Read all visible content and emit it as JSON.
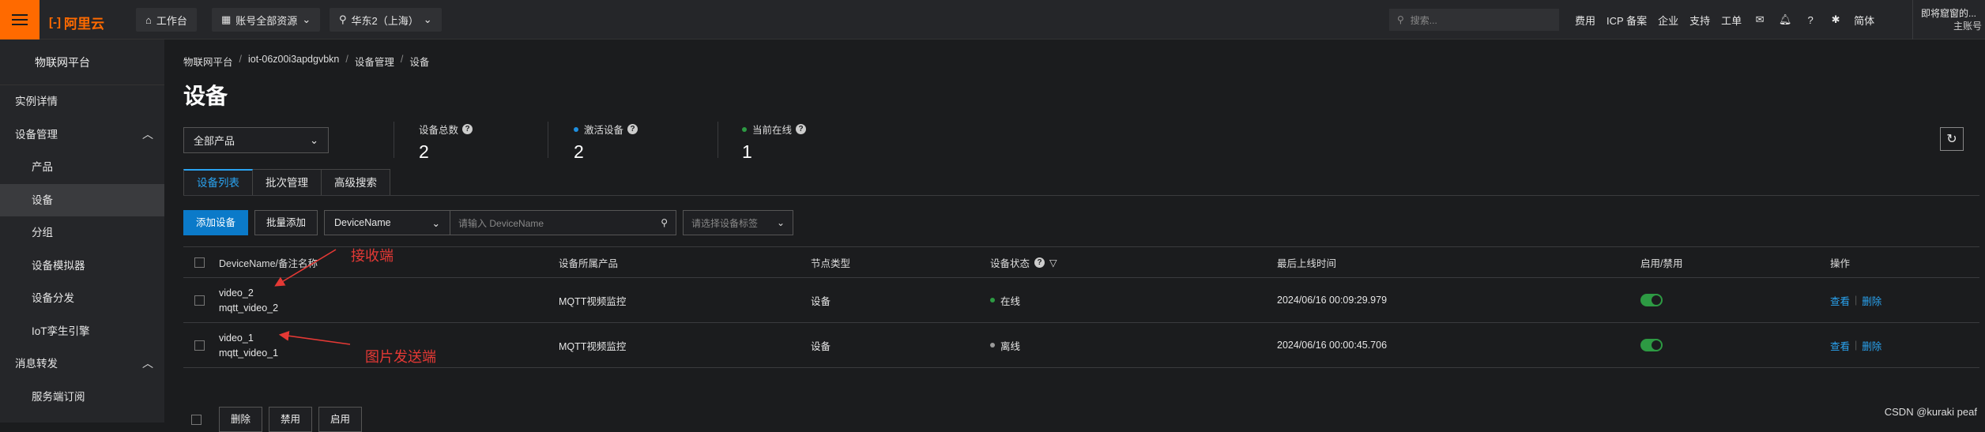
{
  "topbar": {
    "brand": "阿里云",
    "workbench": "工作台",
    "account": "账号全部资源",
    "region": "华东2（上海）",
    "search_placeholder": "搜索...",
    "links": [
      "费用",
      "ICP 备案",
      "企业",
      "支持",
      "工单"
    ],
    "lang": "简体",
    "user_line1": "即将窟窗的...",
    "user_line2": "主账号"
  },
  "sidebar": {
    "title": "物联网平台",
    "items": [
      {
        "label": "实例详情",
        "level": "top"
      },
      {
        "label": "设备管理",
        "level": "top",
        "expanded": true
      },
      {
        "label": "产品",
        "level": "sub"
      },
      {
        "label": "设备",
        "level": "sub",
        "active": true
      },
      {
        "label": "分组",
        "level": "sub"
      },
      {
        "label": "设备模拟器",
        "level": "sub"
      },
      {
        "label": "设备分发",
        "level": "sub"
      },
      {
        "label": "IoT孪生引擎",
        "level": "sub"
      },
      {
        "label": "消息转发",
        "level": "top",
        "expanded": true
      },
      {
        "label": "服务端订阅",
        "level": "sub"
      }
    ]
  },
  "breadcrumb": [
    "物联网平台",
    "iot-06z00i3apdgvbkn",
    "设备管理",
    "设备"
  ],
  "page_title": "设备",
  "product_select": "全部产品",
  "stats": [
    {
      "label": "设备总数",
      "value": "2",
      "dot": null
    },
    {
      "label": "激活设备",
      "value": "2",
      "dot": "#1e8fe0"
    },
    {
      "label": "当前在线",
      "value": "1",
      "dot": "#2d9a43"
    }
  ],
  "tabs": [
    "设备列表",
    "批次管理",
    "高级搜索"
  ],
  "toolbar": {
    "add_device": "添加设备",
    "batch_add": "批量添加",
    "field_select": "DeviceName",
    "search_placeholder": "请输入 DeviceName",
    "tag_placeholder": "请选择设备标签"
  },
  "table": {
    "headers": [
      "DeviceName/备注名称",
      "设备所属产品",
      "节点类型",
      "设备状态",
      "最后上线时间",
      "启用/禁用",
      "操作"
    ],
    "rows": [
      {
        "name": "video_2",
        "remark": "mqtt_video_2",
        "product": "MQTT视频监控",
        "node": "设备",
        "status": "在线",
        "status_color": "#2d9a43",
        "last_online": "2024/06/16 00:09:29.979",
        "enabled": true,
        "actions": [
          "查看",
          "删除"
        ]
      },
      {
        "name": "video_1",
        "remark": "mqtt_video_1",
        "product": "MQTT视频监控",
        "node": "设备",
        "status": "离线",
        "status_color": "#9a9a9a",
        "last_online": "2024/06/16 00:00:45.706",
        "enabled": true,
        "actions": [
          "查看",
          "删除"
        ]
      }
    ]
  },
  "footer_buttons": [
    "删除",
    "禁用",
    "启用"
  ],
  "annotations": [
    "接收端",
    "图片发送端"
  ],
  "watermark": "CSDN @kuraki peaf",
  "colors": {
    "accent": "#ff6a00",
    "link": "#2aa3f0",
    "primary_button": "#0b7ac9",
    "annotation": "#e53935"
  }
}
